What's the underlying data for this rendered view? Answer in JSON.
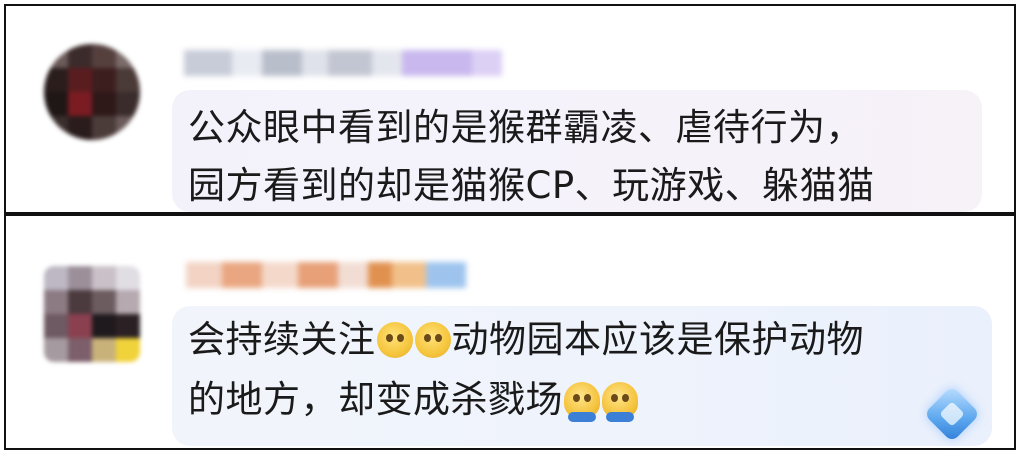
{
  "comments": [
    {
      "text_lines": [
        "公众眼中看到的是猴群霸凌、虐待行为，",
        "园方看到的却是猫猴CP、玩游戏、躲猫猫"
      ]
    },
    {
      "text_line1_a": "会持续关注",
      "text_line1_b": "动物园本应该是保护动物",
      "text_line2": "的地方，却变成杀戮场"
    }
  ],
  "colors": {
    "frame_border": "#111111",
    "bubble1": "#f4f2fa",
    "bubble2": "#eef3fc",
    "text": "#1a1a1a"
  },
  "icons": [
    "avatar-1-blurred",
    "avatar-2-blurred",
    "smile-emoji",
    "smile-emoji",
    "sweat-emoji",
    "sweat-emoji",
    "diamond-badge-icon"
  ]
}
